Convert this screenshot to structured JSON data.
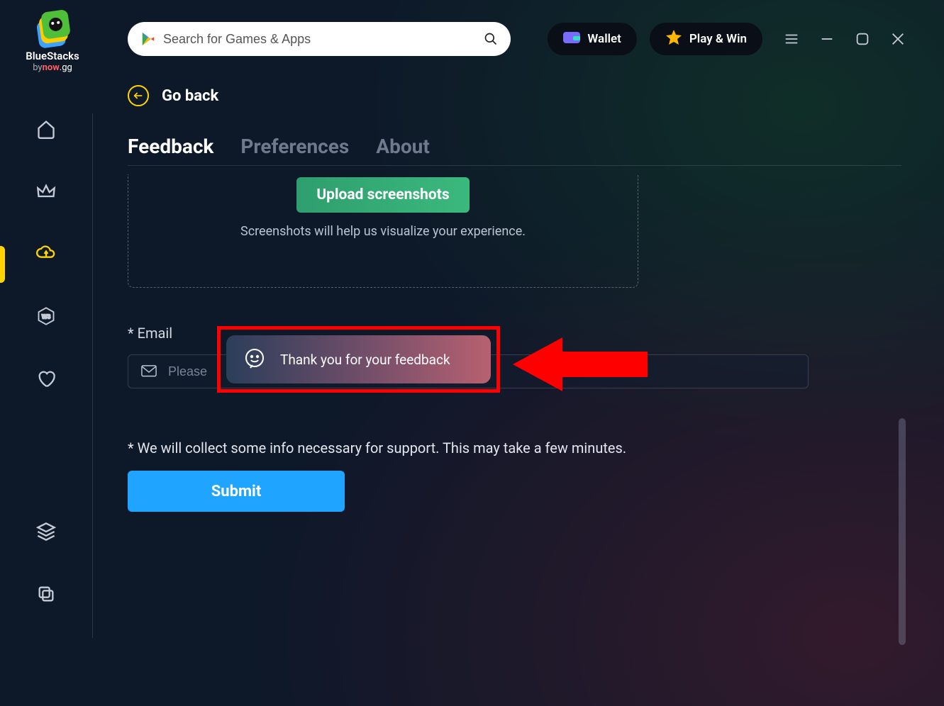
{
  "brand": {
    "name": "BlueStacks",
    "sub_prefix": "by",
    "sub_now": "now",
    "sub_gg": ".gg"
  },
  "search": {
    "placeholder": "Search for Games & Apps"
  },
  "header": {
    "wallet": "Wallet",
    "playwin": "Play & Win"
  },
  "main": {
    "goback": "Go back",
    "tabs": {
      "feedback": "Feedback",
      "preferences": "Preferences",
      "about": "About"
    },
    "upload": {
      "button": "Upload screenshots",
      "hint": "Screenshots will help us visualize your experience."
    },
    "email": {
      "label": "* Email",
      "placeholder": "Please"
    },
    "note": "* We will collect some info necessary for support. This may take a few minutes.",
    "submit": "Submit",
    "toast": "Thank you for your feedback"
  }
}
